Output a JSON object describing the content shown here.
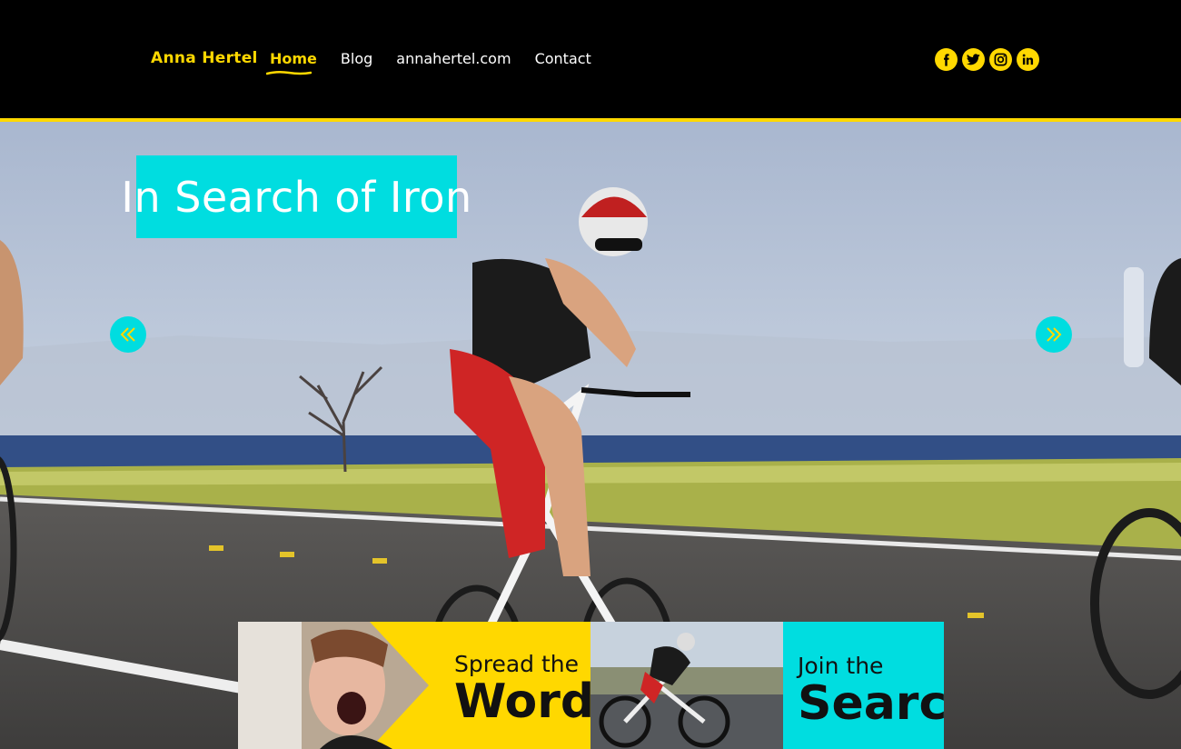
{
  "header": {
    "brand": "Anna Hertel",
    "nav": [
      {
        "label": "Home",
        "active": true
      },
      {
        "label": "Blog",
        "active": false
      },
      {
        "label": "annahertel.com",
        "active": false
      },
      {
        "label": "Contact",
        "active": false
      }
    ],
    "social": [
      "facebook-icon",
      "twitter-icon",
      "instagram-icon",
      "linkedin-icon"
    ]
  },
  "hero": {
    "title": "In Search of Iron",
    "prev_icon": "double-chevron-left-icon",
    "next_icon": "double-chevron-right-icon"
  },
  "tiles": [
    {
      "small": "Spread the",
      "big": "Word"
    },
    {
      "small": "Join the",
      "big": "Search"
    }
  ],
  "colors": {
    "accent_yellow": "#ffd800",
    "accent_cyan": "#00dde0",
    "header_bg": "#000000"
  }
}
